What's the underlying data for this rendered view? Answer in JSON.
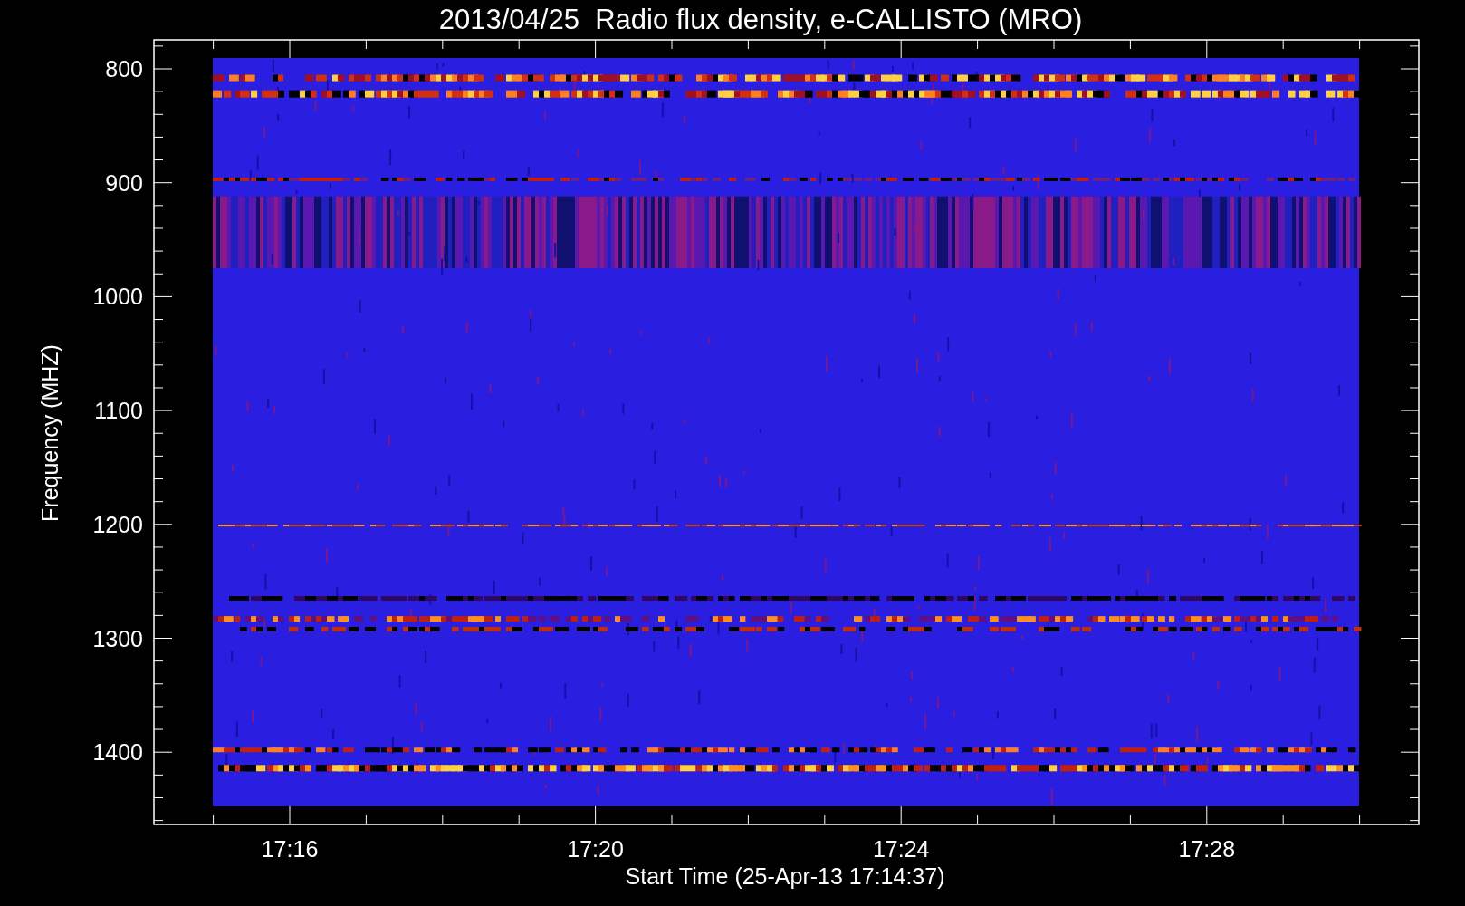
{
  "title": "2013/04/25  Radio flux density, e-CALLISTO (MRO)",
  "y_axis": {
    "label": "Frequency (MHZ)",
    "ticks": [
      "800",
      "900",
      "1000",
      "1100",
      "1200",
      "1300",
      "1400"
    ]
  },
  "x_axis": {
    "label": "Start Time (25-Apr-13 17:14:37)",
    "ticks": [
      "17:16",
      "17:20",
      "17:24",
      "17:28"
    ]
  }
}
